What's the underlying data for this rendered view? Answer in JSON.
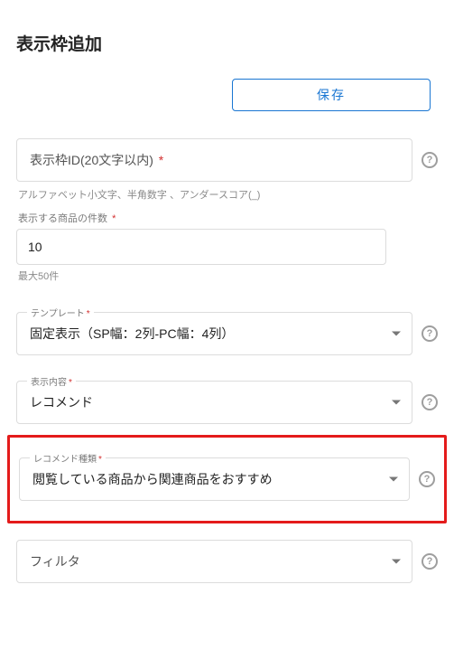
{
  "page": {
    "title": "表示枠追加"
  },
  "actions": {
    "save_label": "保存"
  },
  "fields": {
    "frame_id": {
      "label": "表示枠ID(20文字以内)",
      "hint": "アルファベット小文字、半角数字 、アンダースコア(_)"
    },
    "item_count": {
      "label": "表示する商品の件数",
      "value": "10",
      "hint": "最大50件"
    },
    "template": {
      "label": "テンプレート",
      "value": "固定表示（SP幅：2列-PC幅：4列）"
    },
    "display_content": {
      "label": "表示内容",
      "value": "レコメンド"
    },
    "recommend_type": {
      "label": "レコメンド種類",
      "value": "閲覧している商品から関連商品をおすすめ"
    },
    "filter": {
      "label": "フィルタ"
    }
  },
  "icons": {
    "help": "?"
  },
  "required_mark": "*"
}
